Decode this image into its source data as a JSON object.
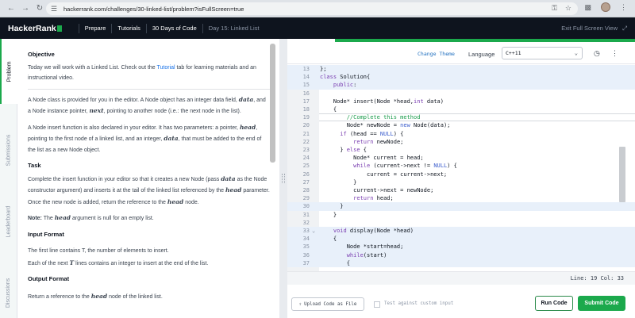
{
  "browser": {
    "url": "hackerrank.com/challenges/30-linked-list/problem?isFullScreen=true"
  },
  "header": {
    "logo": "HackerRank",
    "nav": [
      "Prepare",
      "Tutorials",
      "30 Days of Code",
      "Day 15: Linked List"
    ],
    "exit_fullscreen": "Exit Full Screen View"
  },
  "left_tabs": [
    "Problem",
    "Submissions",
    "Leaderboard",
    "Discussions"
  ],
  "problem": {
    "objective_title": "Objective",
    "objective_pre": "Today we will work with a Linked List. Check out the ",
    "objective_link": "Tutorial",
    "objective_post": " tab for learning materials and an instructional video.",
    "p1_a": "A Node class is provided for you in the editor. A Node object has an integer data field, ",
    "p1_var1": "data",
    "p1_b": ", and a Node instance pointer, ",
    "p1_var2": "next",
    "p1_c": ", pointing to another node (i.e.: the next node in the list).",
    "p2_a": "A Node insert function is also declared in your editor. It has two parameters: a pointer, ",
    "p2_var1": "head",
    "p2_b": ", pointing to the first node of a linked list, and an integer, ",
    "p2_var2": "data",
    "p2_c": ", that must be added to the end of the list as a new Node object.",
    "task_title": "Task",
    "task_a": "Complete the insert function in your editor so that it creates a new Node (pass ",
    "task_var1": "data",
    "task_b": " as the Node constructor argument) and inserts it at the tail of the linked list referenced by the ",
    "task_var2": "head",
    "task_c": " parameter. Once the new node is added, return the reference to the ",
    "task_var3": "head",
    "task_d": " node.",
    "note_label": "Note:",
    "note_a": " The ",
    "note_var": "head",
    "note_b": " argument is null for an empty list.",
    "input_title": "Input Format",
    "input_1": "The first line contains T, the number of elements to insert.",
    "input_2_a": "Each of the next ",
    "input_2_var": "T",
    "input_2_b": " lines contains an integer to insert at the end of the list.",
    "output_title": "Output Format",
    "output_a": "Return a reference to the ",
    "output_var": "head",
    "output_b": " node of the linked list."
  },
  "editor": {
    "change_theme": "Change Theme",
    "language_label": "Language",
    "language_value": "C++11",
    "status": "Line: 19 Col: 33",
    "upload_label": "Upload Code as File",
    "custom_input_label": "Test against custom input",
    "run_label": "Run Code",
    "submit_label": "Submit Code",
    "code_lines": [
      {
        "n": "13",
        "t": "};"
      },
      {
        "n": "14",
        "t": "class Solution{"
      },
      {
        "n": "15",
        "t": "    public:"
      },
      {
        "n": "16",
        "t": ""
      },
      {
        "n": "17",
        "t": "    Node* insert(Node *head,int data)"
      },
      {
        "n": "18",
        "t": "    {"
      },
      {
        "n": "19",
        "t": "        //Complete this method"
      },
      {
        "n": "20",
        "t": "        Node* newNode = new Node(data);"
      },
      {
        "n": "21",
        "t": "      if (head == NULL) {"
      },
      {
        "n": "22",
        "t": "          return newNode;"
      },
      {
        "n": "23",
        "t": "      } else {"
      },
      {
        "n": "24",
        "t": "          Node* current = head;"
      },
      {
        "n": "25",
        "t": "          while (current->next != NULL) {"
      },
      {
        "n": "26",
        "t": "              current = current->next;"
      },
      {
        "n": "27",
        "t": "          }"
      },
      {
        "n": "28",
        "t": "          current->next = newNode;"
      },
      {
        "n": "29",
        "t": "          return head;"
      },
      {
        "n": "30",
        "t": "      }"
      },
      {
        "n": "31",
        "t": "    }"
      },
      {
        "n": "32",
        "t": ""
      },
      {
        "n": "33",
        "t": "    void display(Node *head)"
      },
      {
        "n": "34",
        "t": "    {"
      },
      {
        "n": "35",
        "t": "        Node *start=head;"
      },
      {
        "n": "36",
        "t": "        while(start)"
      },
      {
        "n": "37",
        "t": "        {"
      }
    ]
  },
  "colors": {
    "header_bg": "#0e141e",
    "brand_green": "#1ba94c",
    "link_blue": "#1a73e8"
  }
}
